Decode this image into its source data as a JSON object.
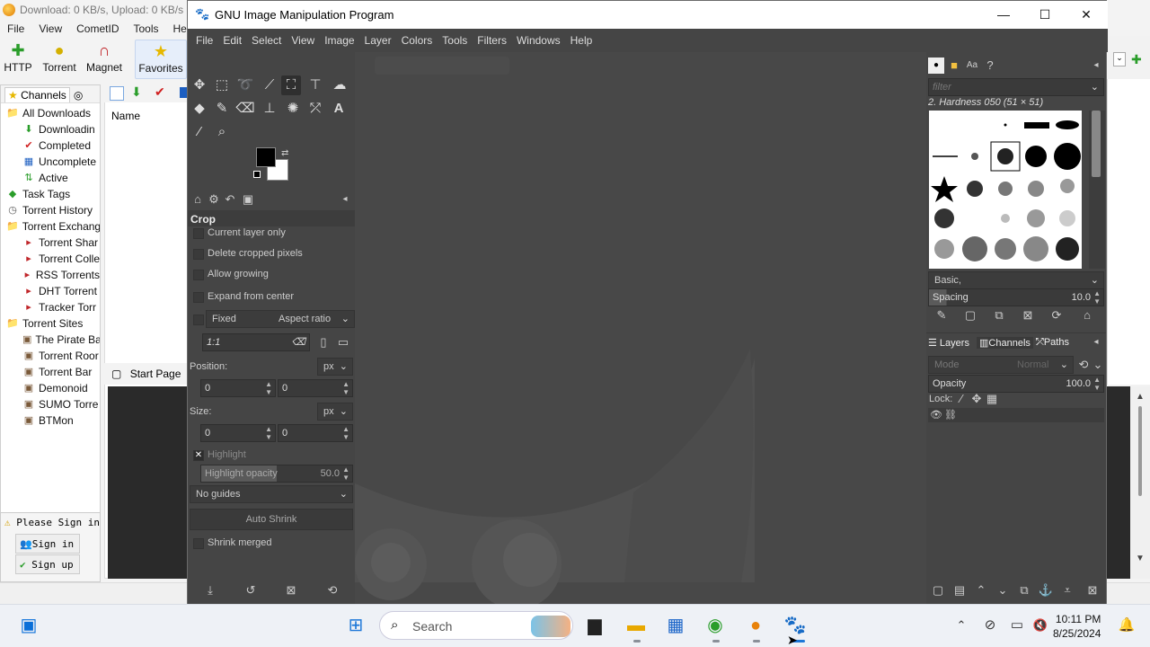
{
  "bitcomet": {
    "title": "Download: 0 KB/s, Upload: 0 KB/s",
    "menu": [
      "File",
      "View",
      "CometID",
      "Tools",
      "Help"
    ],
    "toolbar": {
      "http": "HTTP",
      "torrent": "Torrent",
      "magnet": "Magnet",
      "favorites": "Favorites"
    },
    "left_tab": "Channels",
    "tree": [
      {
        "label": "All Downloads",
        "level": 1,
        "icon": "folder-icon"
      },
      {
        "label": "Downloadin",
        "level": 2,
        "icon": "down-arrow-icon"
      },
      {
        "label": "Completed",
        "level": 2,
        "icon": "check-icon"
      },
      {
        "label": "Uncomplete",
        "level": 2,
        "icon": "blocks-icon"
      },
      {
        "label": "Active",
        "level": 2,
        "icon": "updown-icon"
      },
      {
        "label": "Task Tags",
        "level": 1,
        "icon": "tag-icon"
      },
      {
        "label": "Torrent History",
        "level": 1,
        "icon": "history-icon"
      },
      {
        "label": "Torrent Exchang",
        "level": 1,
        "icon": "folder-icon"
      },
      {
        "label": "Torrent Shar",
        "level": 2,
        "icon": "share-icon"
      },
      {
        "label": "Torrent Colle",
        "level": 2,
        "icon": "collection-icon"
      },
      {
        "label": "RSS Torrents",
        "level": 2,
        "icon": "rss-icon"
      },
      {
        "label": "DHT Torrent",
        "level": 2,
        "icon": "dht-icon"
      },
      {
        "label": "Tracker Torr",
        "level": 2,
        "icon": "tracker-icon"
      },
      {
        "label": "Torrent Sites",
        "level": 1,
        "icon": "folder-icon"
      },
      {
        "label": "The Pirate Ba",
        "level": 2,
        "icon": "site-icon"
      },
      {
        "label": "Torrent Roor",
        "level": 2,
        "icon": "site-icon"
      },
      {
        "label": "Torrent Bar",
        "level": 2,
        "icon": "site-icon"
      },
      {
        "label": "Demonoid",
        "level": 2,
        "icon": "site-icon"
      },
      {
        "label": "SUMO Torre",
        "level": 2,
        "icon": "site-icon"
      },
      {
        "label": "BTMon",
        "level": 2,
        "icon": "site-icon"
      }
    ],
    "sign_notice": "Please Sign in",
    "sign_in": "Sign in",
    "sign_up": "Sign up",
    "column_name": "Name",
    "start_page": "Start Page"
  },
  "gimp": {
    "title": "GNU Image Manipulation Program",
    "menu": [
      "File",
      "Edit",
      "Select",
      "View",
      "Image",
      "Layer",
      "Colors",
      "Tools",
      "Filters",
      "Windows",
      "Help"
    ],
    "tool_options": {
      "title": "Crop",
      "current_layer_only": "Current layer only",
      "delete_cropped": "Delete cropped pixels",
      "allow_growing": "Allow growing",
      "expand_from_center": "Expand from center",
      "fixed": "Fixed",
      "aspect_ratio": "Aspect ratio",
      "ratio_value": "1:1",
      "position_label": "Position:",
      "position_unit": "px",
      "position_x": "0",
      "position_y": "0",
      "size_label": "Size:",
      "size_unit": "px",
      "size_w": "0",
      "size_h": "0",
      "highlight": "Highlight",
      "highlight_opacity_label": "Highlight opacity",
      "highlight_opacity_value": "50.0",
      "guides": "No guides",
      "auto_shrink": "Auto Shrink",
      "shrink_merged": "Shrink merged"
    },
    "brushes": {
      "filter_placeholder": "filter",
      "selected_brush": "2. Hardness 050 (51 × 51)",
      "tag": "Basic,",
      "spacing_label": "Spacing",
      "spacing_value": "10.0"
    },
    "layers": {
      "tab_layers": "Layers",
      "tab_channels": "Channels",
      "tab_paths": "Paths",
      "mode_label": "Mode",
      "mode_value": "Normal",
      "opacity_label": "Opacity",
      "opacity_value": "100.0",
      "lock_label": "Lock:"
    }
  },
  "taskbar": {
    "search": "Search",
    "time": "10:11 PM",
    "date": "8/25/2024"
  }
}
